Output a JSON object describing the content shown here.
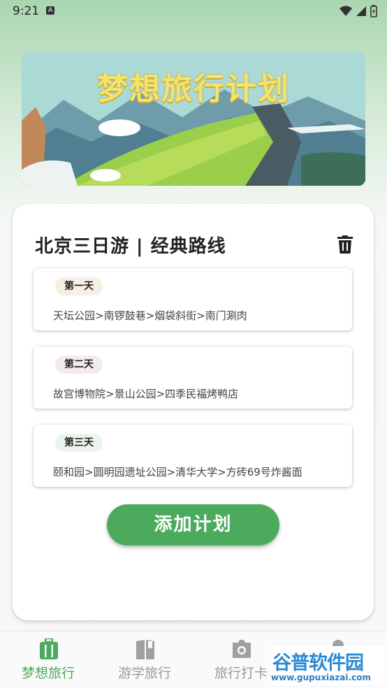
{
  "status_bar": {
    "time": "9:21",
    "notification_letter": "A"
  },
  "banner": {
    "title": "梦想旅行计划"
  },
  "plan": {
    "title": "北京三日游 | 经典路线",
    "days": [
      {
        "label": "第一天",
        "route": "天坛公园>南锣鼓巷>烟袋斜街>南门涮肉",
        "badge_color": "#f7efe4"
      },
      {
        "label": "第二天",
        "route": "故宫博物院>景山公园>四季民福烤鸭店",
        "badge_color": "#f4eaf2"
      },
      {
        "label": "第三天",
        "route": "颐和园>圆明园遗址公园>清华大学>方砖69号炸酱面",
        "badge_color": "#eaf4ec"
      }
    ],
    "add_button": "添加计划"
  },
  "tabs": [
    {
      "label": "梦想旅行",
      "icon": "suitcase-icon",
      "active": true
    },
    {
      "label": "游学旅行",
      "icon": "book-icon",
      "active": false
    },
    {
      "label": "旅行打卡",
      "icon": "camera-icon",
      "active": false
    },
    {
      "label": "",
      "icon": "profile-icon",
      "active": false
    }
  ],
  "watermark": {
    "brand": "谷普软件园",
    "url": "www.gupuxiazai.com"
  },
  "colors": {
    "accent": "#4caa5d",
    "inactive": "#9a9a9a"
  }
}
